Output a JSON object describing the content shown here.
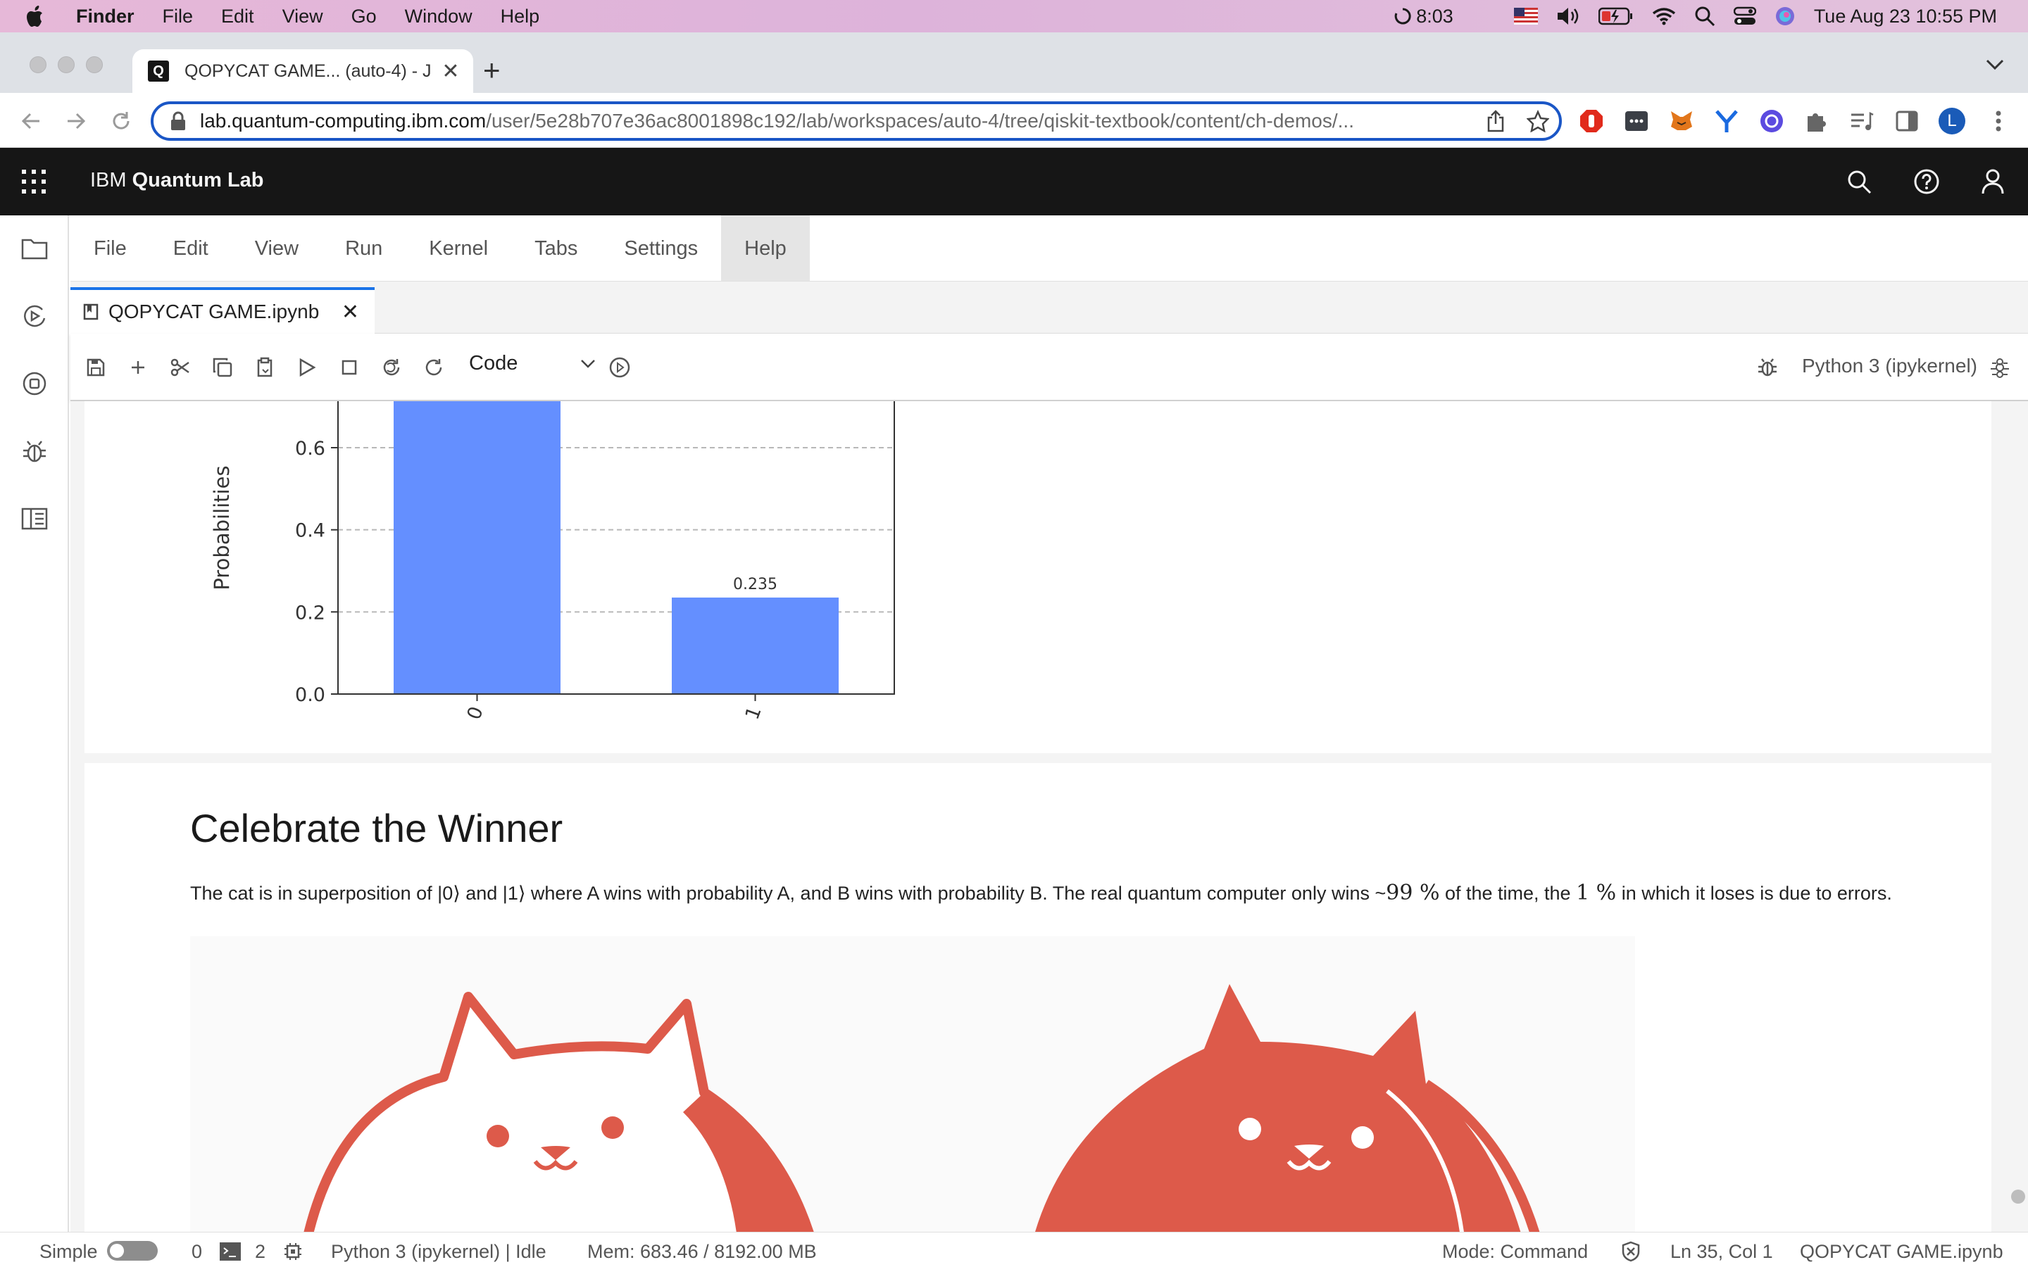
{
  "macos_menu": {
    "app": "Finder",
    "items": [
      "File",
      "Edit",
      "View",
      "Go",
      "Window",
      "Help"
    ],
    "battery_time": "8:03",
    "clock": "Tue Aug 23  10:55 PM"
  },
  "browser": {
    "tab_title": "QOPYCAT GAME... (auto-4) - J",
    "tab_favicon": "Q",
    "url_host": "lab.quantum-computing.ibm.com",
    "url_path": "/user/5e28b707e36ac8001898c192/lab/workspaces/auto-4/tree/qiskit-textbook/content/ch-demos/...",
    "profile_initial": "L"
  },
  "ibm_bar": {
    "brand_prefix": "IBM",
    "brand_name": "Quantum Lab"
  },
  "menu": {
    "items": [
      "File",
      "Edit",
      "View",
      "Run",
      "Kernel",
      "Tabs",
      "Settings",
      "Help"
    ],
    "active": "Help"
  },
  "doc_tab": {
    "name": "QOPYCAT GAME.ipynb"
  },
  "nb_toolbar": {
    "cell_type": "Code",
    "kernel": "Python 3 (ipykernel)"
  },
  "chart_data": {
    "type": "bar",
    "categories": [
      "0",
      "1"
    ],
    "values": [
      0.765,
      0.235
    ],
    "data_labels": [
      "",
      "0.235"
    ],
    "ylabel": "Probabilities",
    "yticks": [
      "0.0",
      "0.2",
      "0.4",
      "0.6"
    ],
    "ylim": [
      0,
      0.72
    ],
    "bar_color": "#648fff",
    "grid": true
  },
  "markdown": {
    "heading": "Celebrate the Winner",
    "p1": "The cat is in superposition of |0⟩ and |1⟩ where A wins with probability A, and B wins with probability B. The real quantum computer only wins ~",
    "p_math1": "99 %",
    "p2": " of the time, the ",
    "p_math2": "1 %",
    "p3": " in which it loses is due to errors."
  },
  "status": {
    "mode_label": "Simple",
    "terminals": "0",
    "kernels": "2",
    "kernel_state": "Python 3 (ipykernel) | Idle",
    "memory": "Mem: 683.46 / 8192.00 MB",
    "command_mode": "Mode: Command",
    "cursor": "Ln 35, Col 1",
    "file": "QOPYCAT GAME.ipynb"
  },
  "colors": {
    "cat_red": "#dd5a4a",
    "chart_bar": "#648fff",
    "accent_blue": "#1a73e8",
    "ibm_bar": "#161616"
  }
}
